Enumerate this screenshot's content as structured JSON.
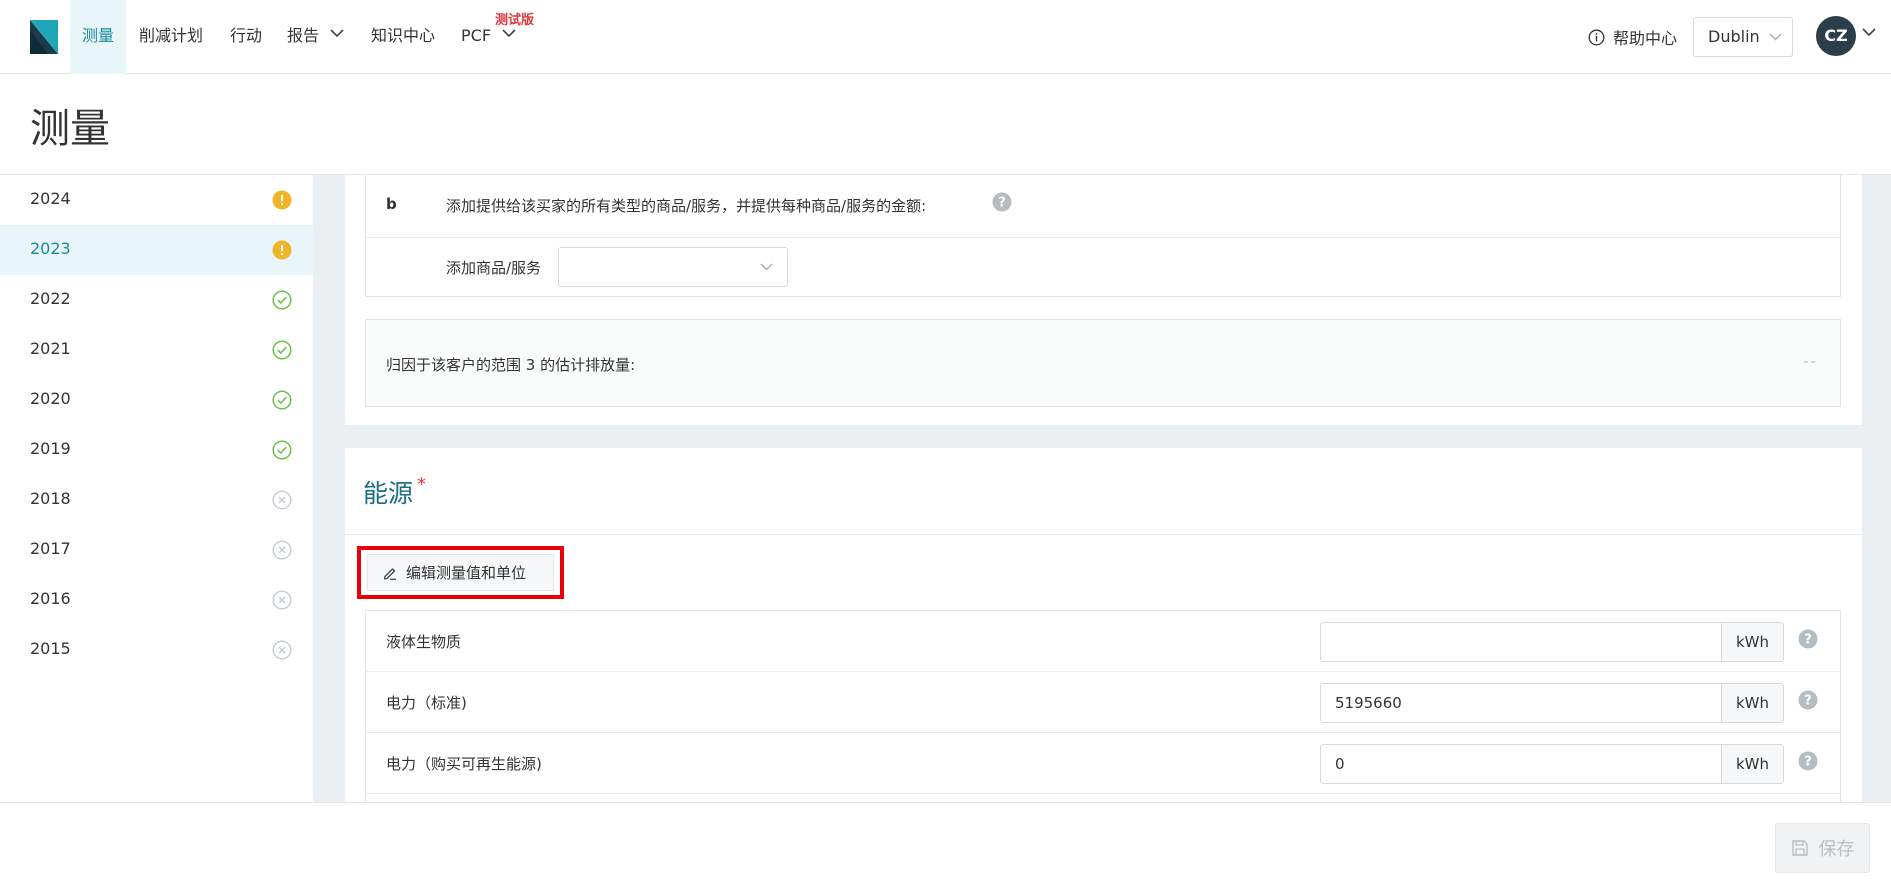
{
  "nav": {
    "items": [
      {
        "label": "测量",
        "active": true
      },
      {
        "label": "削减计划"
      },
      {
        "label": "行动"
      },
      {
        "label": "报告"
      },
      {
        "label": "知识中心"
      },
      {
        "label": "PCF"
      }
    ],
    "beta_badge": "测试版",
    "help_label": "帮助中心",
    "city": "Dublin",
    "avatar_initials": "CZ"
  },
  "page": {
    "title": "测量"
  },
  "sidebar": {
    "years": [
      {
        "year": "2024",
        "status": "warning"
      },
      {
        "year": "2023",
        "status": "warning",
        "active": true
      },
      {
        "year": "2022",
        "status": "complete"
      },
      {
        "year": "2021",
        "status": "complete"
      },
      {
        "year": "2020",
        "status": "complete"
      },
      {
        "year": "2019",
        "status": "complete"
      },
      {
        "year": "2018",
        "status": "incomplete"
      },
      {
        "year": "2017",
        "status": "incomplete"
      },
      {
        "year": "2016",
        "status": "incomplete"
      },
      {
        "year": "2015",
        "status": "incomplete"
      }
    ]
  },
  "buyer_section": {
    "question_letter": "b",
    "question_text": "添加提供给该买家的所有类型的商品/服务，并提供每种商品/服务的金额:",
    "add_label": "添加商品/服务",
    "add_select_value": "",
    "estimate_label": "归因于该客户的范围 3 的估计排放量:",
    "estimate_value": "--"
  },
  "energy": {
    "title": "能源",
    "required_mark": "*",
    "edit_button_label": "编辑测量值和单位",
    "rows": [
      {
        "label": "液体生物质",
        "value": "",
        "unit": "kWh"
      },
      {
        "label": "电力（标准)",
        "value": "5195660",
        "unit": "kWh"
      },
      {
        "label": "电力（购买可再生能源)",
        "value": "0",
        "unit": "kWh"
      }
    ]
  },
  "footer": {
    "save_label": "保存"
  },
  "colors": {
    "accent": "#1b8a9e",
    "warning": "#f0b429",
    "success": "#6cc04a",
    "muted": "#c5cbd0",
    "highlight": "#e8000c"
  }
}
